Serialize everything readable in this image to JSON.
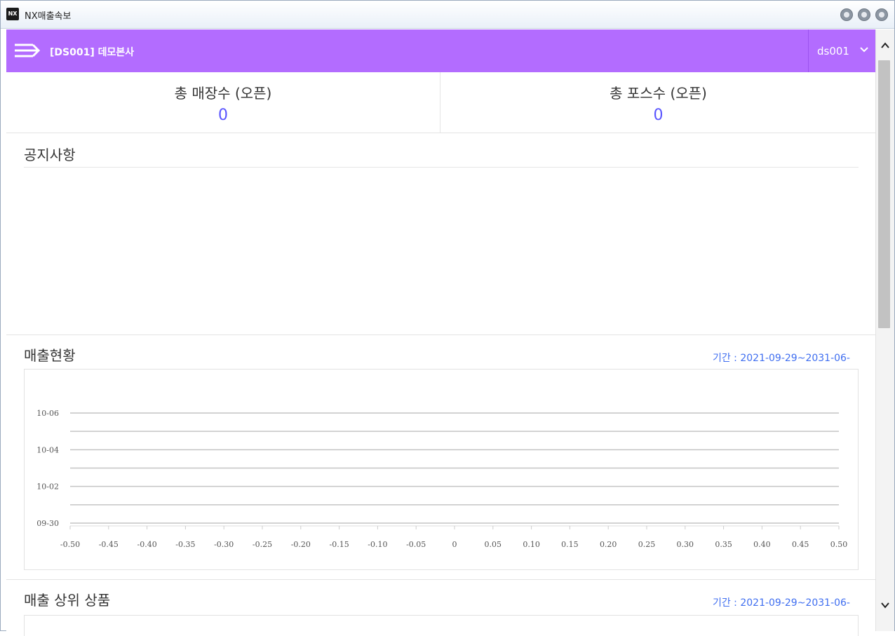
{
  "window": {
    "title": "NX매출속보",
    "icon_text": "NX"
  },
  "header": {
    "company": "[DS001] 데모본사",
    "user": "ds001",
    "background": "#b36cff"
  },
  "stats": {
    "stores_label": "총 매장수 (오픈)",
    "stores_value": "0",
    "pos_label": "총 포스수 (오픈)",
    "pos_value": "0",
    "value_color": "#5a55ff"
  },
  "notice": {
    "title": "공지사항"
  },
  "sales": {
    "title": "매출현황",
    "period": "기간 : 2021-09-29~2031-06-"
  },
  "top_products": {
    "title": "매출 상위 상품",
    "period": "기간 : 2021-09-29~2031-06-"
  },
  "chart_data": {
    "type": "bar",
    "orientation": "horizontal",
    "x_ticks": [
      "-0.50",
      "-0.45",
      "-0.40",
      "-0.35",
      "-0.30",
      "-0.25",
      "-0.20",
      "-0.15",
      "-0.10",
      "-0.05",
      "0",
      "0.05",
      "0.10",
      "0.15",
      "0.20",
      "0.25",
      "0.30",
      "0.35",
      "0.40",
      "0.45",
      "0.50"
    ],
    "xlim": [
      -0.5,
      0.5
    ],
    "y_ticks": [
      "10-06",
      "10-04",
      "10-02",
      "09-30"
    ],
    "y_labeled_rows": 7,
    "series": [],
    "grid": true,
    "title": "",
    "xlabel": "",
    "ylabel": ""
  }
}
